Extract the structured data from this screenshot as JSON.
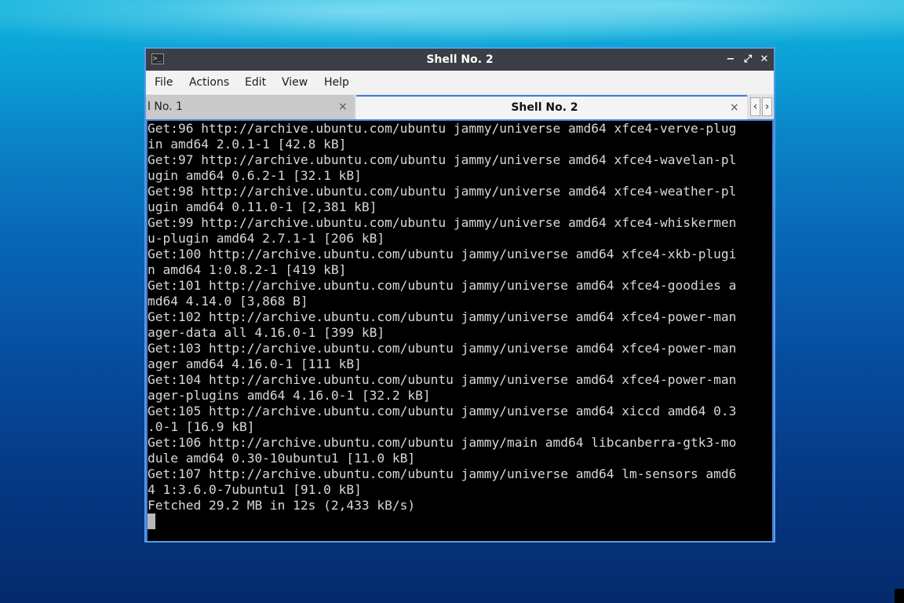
{
  "window": {
    "title": "Shell No. 2",
    "icon": "terminal-icon",
    "icon_glyph": ">_",
    "controls": {
      "minimize": "−",
      "maximize": "⤢",
      "close": "✕"
    }
  },
  "menu": {
    "items": [
      "File",
      "Actions",
      "Edit",
      "View",
      "Help"
    ]
  },
  "tabs": [
    {
      "label": "l No. 1",
      "close": "×",
      "active": false
    },
    {
      "label": "Shell No. 2",
      "close": "×",
      "active": true
    }
  ],
  "tab_scroll": {
    "left": "‹",
    "right": "›"
  },
  "terminal": {
    "lines": [
      "Get:96 http://archive.ubuntu.com/ubuntu jammy/universe amd64 xfce4-verve-plug",
      "in amd64 2.0.1-1 [42.8 kB]",
      "Get:97 http://archive.ubuntu.com/ubuntu jammy/universe amd64 xfce4-wavelan-pl",
      "ugin amd64 0.6.2-1 [32.1 kB]",
      "Get:98 http://archive.ubuntu.com/ubuntu jammy/universe amd64 xfce4-weather-pl",
      "ugin amd64 0.11.0-1 [2,381 kB]",
      "Get:99 http://archive.ubuntu.com/ubuntu jammy/universe amd64 xfce4-whiskermen",
      "u-plugin amd64 2.7.1-1 [206 kB]",
      "Get:100 http://archive.ubuntu.com/ubuntu jammy/universe amd64 xfce4-xkb-plugi",
      "n amd64 1:0.8.2-1 [419 kB]",
      "Get:101 http://archive.ubuntu.com/ubuntu jammy/universe amd64 xfce4-goodies a",
      "md64 4.14.0 [3,868 B]",
      "Get:102 http://archive.ubuntu.com/ubuntu jammy/universe amd64 xfce4-power-man",
      "ager-data all 4.16.0-1 [399 kB]",
      "Get:103 http://archive.ubuntu.com/ubuntu jammy/universe amd64 xfce4-power-man",
      "ager amd64 4.16.0-1 [111 kB]",
      "Get:104 http://archive.ubuntu.com/ubuntu jammy/universe amd64 xfce4-power-man",
      "ager-plugins amd64 4.16.0-1 [32.2 kB]",
      "Get:105 http://archive.ubuntu.com/ubuntu jammy/universe amd64 xiccd amd64 0.3",
      ".0-1 [16.9 kB]",
      "Get:106 http://archive.ubuntu.com/ubuntu jammy/main amd64 libcanberra-gtk3-mo",
      "dule amd64 0.30-10ubuntu1 [11.0 kB]",
      "Get:107 http://archive.ubuntu.com/ubuntu jammy/universe amd64 lm-sensors amd6",
      "4 1:3.6.0-7ubuntu1 [91.0 kB]",
      "Fetched 29.2 MB in 12s (2,433 kB/s)"
    ]
  },
  "colors": {
    "accent": "#3c7fd4",
    "titlebar": "#3b3f45",
    "terminal_bg": "#000000",
    "terminal_fg": "#d8d8d8"
  }
}
